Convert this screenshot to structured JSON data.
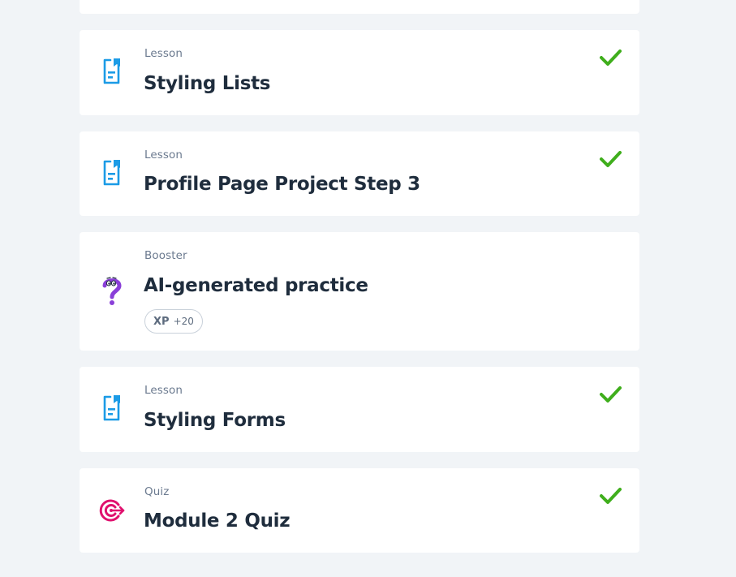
{
  "items": [
    {
      "type": "Lesson",
      "title": "Styling Lists",
      "completed": true,
      "icon": "lesson-document-icon"
    },
    {
      "type": "Lesson",
      "title": "Profile Page Project Step 3",
      "completed": true,
      "icon": "lesson-document-icon"
    },
    {
      "type": "Booster",
      "title": "AI-generated practice",
      "completed": false,
      "icon": "booster-question-icon",
      "xp": {
        "label": "XP",
        "value": "+20"
      }
    },
    {
      "type": "Lesson",
      "title": "Styling Forms",
      "completed": true,
      "icon": "lesson-document-icon"
    },
    {
      "type": "Quiz",
      "title": "Module 2 Quiz",
      "completed": true,
      "icon": "quiz-target-icon"
    }
  ],
  "colors": {
    "background": "#f1f4f7",
    "card": "#ffffff",
    "check": "#3fae1c",
    "lesson_icon": "#1b9be6",
    "booster_icon": "#8a3fd8",
    "quiz_icon": "#e0116e",
    "title": "#1f2d3d",
    "kind": "#6b7a8f"
  }
}
